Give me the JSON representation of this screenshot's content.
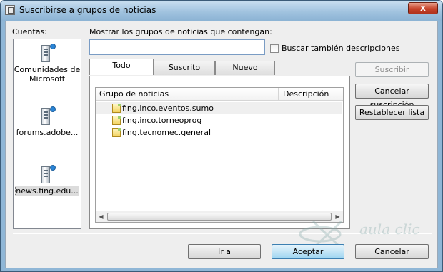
{
  "window": {
    "title": "Suscribirse a grupos de noticias",
    "close_glyph": "x"
  },
  "accounts": {
    "label": "Cuentas:",
    "items": [
      {
        "label": "Comunidades de Microsoft",
        "icon": "server-icon"
      },
      {
        "label": "forums.adobe...",
        "icon": "server-icon"
      },
      {
        "label": "news.fing.edu...",
        "icon": "server-icon"
      }
    ]
  },
  "search": {
    "label": "Mostrar los grupos de noticias que contengan:",
    "value": "",
    "checkbox_label": "Buscar también descripciones"
  },
  "tabs": [
    {
      "label": "Todo"
    },
    {
      "label": "Suscrito"
    },
    {
      "label": "Nuevo"
    }
  ],
  "list": {
    "columns": [
      "Grupo de noticias",
      "Descripción"
    ],
    "rows": [
      {
        "name": "fing.inco.eventos.sumo",
        "icon": "newsgroup-icon"
      },
      {
        "name": "fing.inco.torneoprog",
        "icon": "newsgroup-icon"
      },
      {
        "name": "fing.tecnomec.general",
        "icon": "newsgroup-icon"
      }
    ]
  },
  "side_buttons": {
    "subscribe": "Suscribir",
    "unsubscribe": "Cancelar suscripción",
    "reset": "Restablecer lista"
  },
  "footer_buttons": {
    "goto": "Ir a",
    "ok": "Aceptar",
    "cancel": "Cancelar"
  },
  "watermark": {
    "text": "aula clic"
  }
}
